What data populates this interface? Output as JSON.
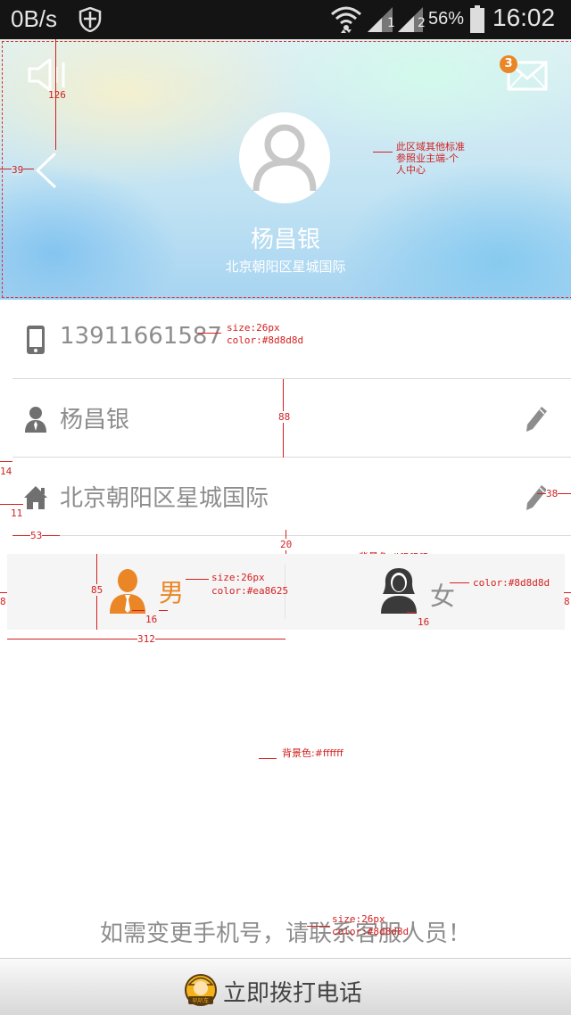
{
  "status_bar": {
    "net_speed": "0B/s",
    "battery_percent": "56%",
    "time": "16:02",
    "signal_sub1": "1",
    "signal_sub2": "2"
  },
  "header": {
    "name": "杨昌银",
    "address": "北京朝阳区星城国际",
    "mail_badge": "3"
  },
  "rows": {
    "phone": "13911661587",
    "name": "杨昌银",
    "address": "北京朝阳区星城国际"
  },
  "gender": {
    "male_label": "男",
    "female_label": "女",
    "selected": "male"
  },
  "notice": "如需变更手机号，请联系客服人员！",
  "call_button": {
    "label": "立即拨打电话",
    "logo_text": "叭叭车"
  },
  "colors": {
    "accent": "#ea8625",
    "text": "#8d8d8d",
    "panel_bg": "#f5f5f5",
    "page_bg": "#ffffff",
    "annotation": "#d42020"
  },
  "annotations": {
    "header_top": "126",
    "header_left": "39",
    "header_note": "此区域其他标准\n参照业主端-个\n人中心",
    "phone_spec_size": "size:26px",
    "phone_spec_color": "color:#8d8d8d",
    "row_height": "88",
    "row_left": "14",
    "icon_left": "11",
    "text_left": "53",
    "edit_right": "38",
    "panel_gap": "20",
    "panel_bg": "背景色:#f5f5f5",
    "panel_height": "85",
    "male_spec_size": "size:26px",
    "male_spec_color": "color:#ea8625",
    "male_gap": "16",
    "female_spec_color": "color:#8d8d8d",
    "female_gap": "16",
    "panel_side_left": "8",
    "panel_side_right": "8",
    "panel_half_width": "312",
    "page_bg": "背景色:#ffffff",
    "notice_spec_size": "size:26px",
    "notice_spec_color": "color:#8d8d8d"
  }
}
